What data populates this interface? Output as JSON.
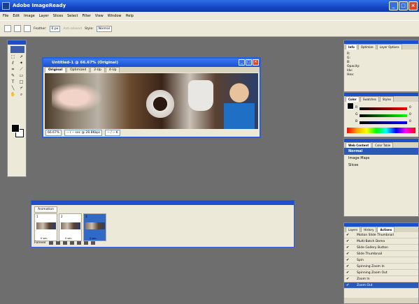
{
  "app": {
    "title": "Adobe ImageReady"
  },
  "menu": [
    "File",
    "Edit",
    "Image",
    "Layer",
    "Slices",
    "Select",
    "Filter",
    "View",
    "Window",
    "Help"
  ],
  "options": {
    "feather_label": "Feather:",
    "feather_value": "0 px",
    "antialiased_label": "Anti-aliased",
    "style_label": "Style:",
    "style_value": "Normal"
  },
  "document": {
    "title": "Untitled-1 @ 66.67% (Original)",
    "tabs": [
      "Original",
      "Optimized",
      "2-Up",
      "4-Up"
    ],
    "zoom": "66.67%",
    "status_left": "-- / -- sec @ 28.8Kbps",
    "status_right": "-- / -- K"
  },
  "animation": {
    "tab_label": "Animation",
    "frames": [
      {
        "num": "1",
        "delay": "0 sec."
      },
      {
        "num": "2",
        "delay": "0 sec."
      },
      {
        "num": "3",
        "delay": "0 sec."
      }
    ],
    "loop_label": "Forever"
  },
  "info_panel": {
    "tabs": [
      "Info",
      "Optimize",
      "Layer Options"
    ],
    "rows": [
      "R:",
      "G:",
      "B:",
      "Opacity:",
      "Idx:",
      "Hex:"
    ]
  },
  "color_panel": {
    "tabs": [
      "Color",
      "Swatches",
      "Styles"
    ],
    "channels": [
      "R",
      "G",
      "B"
    ],
    "values": [
      "0",
      "0",
      "0"
    ]
  },
  "web_content": {
    "tabs": [
      "Web Content",
      "Color Table"
    ],
    "rows": [
      "Normal",
      "Image Maps",
      "Slices"
    ]
  },
  "actions": {
    "tabs": [
      "Layers",
      "History",
      "Actions"
    ],
    "items": [
      "Motion Slide Thumbnail",
      "Multi-Batch Demo",
      "Slide Gallery Button",
      "Slide Thumbnail",
      "Spin",
      "Spinning Zoom In",
      "Spinning Zoom Out",
      "Zoom In",
      "Zoom Out"
    ],
    "selected_index": 8
  }
}
